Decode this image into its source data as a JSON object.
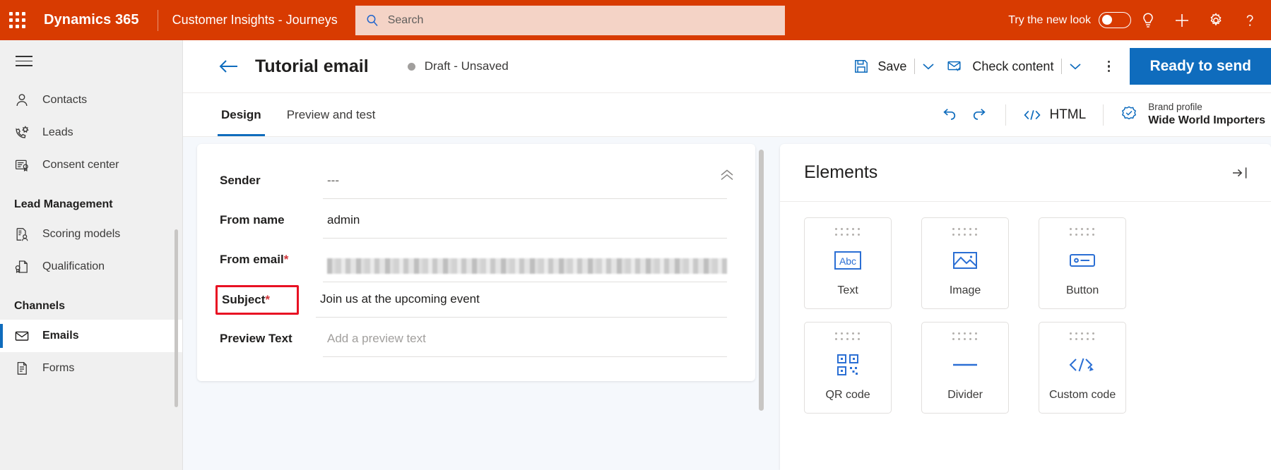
{
  "topbar": {
    "waffle_icon": "waffle-grid-icon",
    "brand": "Dynamics 365",
    "app_name": "Customer Insights - Journeys",
    "search": {
      "placeholder": "Search",
      "icon": "search-icon"
    },
    "new_look_label": "Try the new look",
    "new_look_on": false,
    "icons": [
      "lightbulb-icon",
      "plus-icon",
      "gear-icon",
      "help-icon"
    ],
    "bg_color": "#d83b01",
    "search_bg_color": "#f4d3c6"
  },
  "sidebar": {
    "hamburger_icon": "hamburger-icon",
    "items": [
      {
        "label": "Contacts",
        "icon": "person-icon",
        "selected": false
      },
      {
        "label": "Leads",
        "icon": "phone-lead-icon",
        "selected": false
      },
      {
        "label": "Consent center",
        "icon": "consent-document-icon",
        "selected": false
      }
    ],
    "groups": [
      {
        "title": "Lead Management",
        "items": [
          {
            "label": "Scoring models",
            "icon": "scoring-document-icon",
            "selected": false
          },
          {
            "label": "Qualification",
            "icon": "qualification-document-icon",
            "selected": false
          }
        ]
      },
      {
        "title": "Channels",
        "items": [
          {
            "label": "Emails",
            "icon": "envelope-icon",
            "selected": true
          },
          {
            "label": "Forms",
            "icon": "form-document-icon",
            "selected": false
          }
        ]
      }
    ],
    "selected_accent": "#0f6cbd"
  },
  "command_bar": {
    "back_icon": "back-arrow-icon",
    "title": "Tutorial email",
    "status": "Draft - Unsaved",
    "status_dot_color": "#a19f9d",
    "save": {
      "label": "Save",
      "icon": "save-floppy-icon",
      "chevron": "chevron-down-icon"
    },
    "check_content": {
      "label": "Check content",
      "icon": "envelope-check-icon",
      "chevron": "chevron-down-icon"
    },
    "overflow_icon": "more-vertical-icon",
    "primary": {
      "label": "Ready to send",
      "color": "#0f6cbd"
    }
  },
  "tabs": [
    {
      "label": "Design",
      "active": true
    },
    {
      "label": "Preview and test",
      "active": false
    }
  ],
  "tab_tools": {
    "undo_icon": "undo-icon",
    "redo_icon": "redo-icon",
    "html": {
      "label": "HTML",
      "icon": "code-brackets-icon"
    },
    "brand_profile": {
      "icon": "brand-verified-badge-icon",
      "label": "Brand profile",
      "value": "Wide World Importers"
    }
  },
  "email_form": {
    "collapse_icon": "double-chevron-up-icon",
    "fields": [
      {
        "label": "Sender",
        "required": false,
        "value": "---",
        "placeholder": "",
        "redacted": false,
        "highlighted": false
      },
      {
        "label": "From name",
        "required": false,
        "value": "admin",
        "placeholder": "",
        "redacted": false,
        "highlighted": false
      },
      {
        "label": "From email",
        "required": true,
        "value": "",
        "placeholder": "",
        "redacted": true,
        "highlighted": false
      },
      {
        "label": "Subject",
        "required": true,
        "value": "Join us at the upcoming event",
        "placeholder": "",
        "redacted": false,
        "highlighted": true
      },
      {
        "label": "Preview Text",
        "required": false,
        "value": "",
        "placeholder": "Add a preview text",
        "redacted": false,
        "highlighted": false
      }
    ],
    "highlight_color": "#e81123",
    "required_marker": "*"
  },
  "elements_panel": {
    "title": "Elements",
    "expand_icon": "panel-expand-icon",
    "tiles": [
      {
        "label": "Text",
        "icon": "abc-text-icon"
      },
      {
        "label": "Image",
        "icon": "image-picture-icon"
      },
      {
        "label": "Button",
        "icon": "button-icon"
      },
      {
        "label": "QR code",
        "icon": "qr-code-icon"
      },
      {
        "label": "Divider",
        "icon": "divider-line-icon"
      },
      {
        "label": "Custom code",
        "icon": "custom-code-icon"
      }
    ],
    "icon_color": "#2b6fd4"
  }
}
